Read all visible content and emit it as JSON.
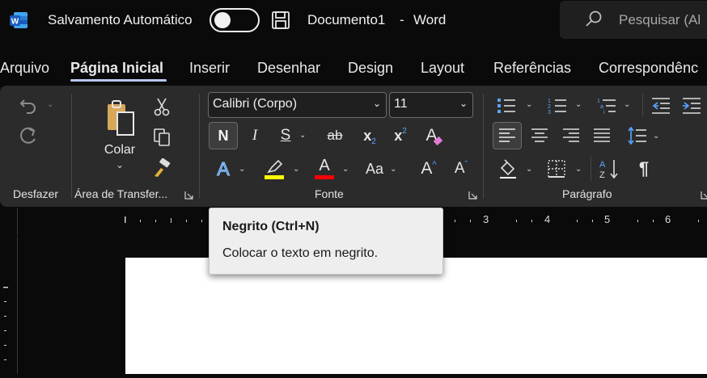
{
  "titlebar": {
    "app_icon": "word-icon",
    "autosave_label": "Salvamento Automático",
    "autosave_state": "off",
    "doc_name": "Documento1",
    "separator": "-",
    "app_name": "Word",
    "search_placeholder": "Pesquisar (Al"
  },
  "tabs": [
    {
      "label": "Arquivo"
    },
    {
      "label": "Página Inicial"
    },
    {
      "label": "Inserir"
    },
    {
      "label": "Desenhar"
    },
    {
      "label": "Design"
    },
    {
      "label": "Layout"
    },
    {
      "label": "Referências"
    },
    {
      "label": "Correspondênc"
    }
  ],
  "ribbon": {
    "undo_group_label": "Desfazer",
    "clipboard": {
      "paste_label": "Colar",
      "group_label": "Área de Transfer..."
    },
    "font": {
      "group_label": "Fonte",
      "font_name": "Calibri (Corpo)",
      "font_size": "11",
      "bold": "N",
      "italic": "I",
      "underline": "S",
      "strike": "ab",
      "subscript_base": "x",
      "subscript_mark": "2",
      "superscript_base": "x",
      "superscript_mark": "2",
      "clear_format": "A",
      "text_effects": "A",
      "font_color": "A",
      "change_case": "Aa",
      "grow": "A",
      "shrink": "A",
      "highlight_color": "#ffff00",
      "font_color_value": "#ff0000"
    },
    "paragraph": {
      "group_label": "Parágrafo",
      "pilcrow": "¶",
      "sort_label": "AZ"
    }
  },
  "ruler": {
    "numbers": [
      "3",
      "4",
      "5",
      "6"
    ]
  },
  "tooltip": {
    "title": "Negrito (Ctrl+N)",
    "description": "Colocar o texto em negrito."
  }
}
